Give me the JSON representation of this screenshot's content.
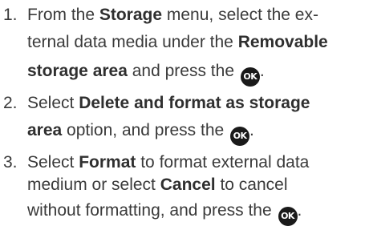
{
  "steps": [
    {
      "number": "1.",
      "lines": [
        [
          {
            "t": "From the ",
            "b": false
          },
          {
            "t": "Storage",
            "b": true
          },
          {
            "t": " menu, select the ex-",
            "b": false
          }
        ],
        [
          {
            "t": "ternal data media under the ",
            "b": false
          },
          {
            "t": "Removable",
            "b": true
          }
        ],
        [
          {
            "t": "storage area",
            "b": true
          },
          {
            "t": " and press the ",
            "b": false
          },
          {
            "icon": "ok-icon",
            "label": "OK"
          },
          {
            "t": ".",
            "b": false
          }
        ]
      ]
    },
    {
      "number": "2.",
      "lines": [
        [
          {
            "t": "Select ",
            "b": false
          },
          {
            "t": "Delete and format as storage",
            "b": true
          }
        ],
        [
          {
            "t": "area",
            "b": true
          },
          {
            "t": " option, and press the ",
            "b": false
          },
          {
            "icon": "ok-icon",
            "label": "OK"
          },
          {
            "t": ".",
            "b": false
          }
        ]
      ]
    },
    {
      "number": "3.",
      "lines": [
        [
          {
            "t": "Select ",
            "b": false
          },
          {
            "t": "Format",
            "b": true
          },
          {
            "t": " to format external data",
            "b": false
          }
        ],
        [
          {
            "t": "medium or select ",
            "b": false
          },
          {
            "t": "Cancel",
            "b": true
          },
          {
            "t": " to cancel",
            "b": false
          }
        ],
        [
          {
            "t": "without formatting, and press the ",
            "b": false
          },
          {
            "icon": "ok-icon",
            "label": "OK"
          },
          {
            "t": ".",
            "b": false
          }
        ]
      ]
    }
  ]
}
